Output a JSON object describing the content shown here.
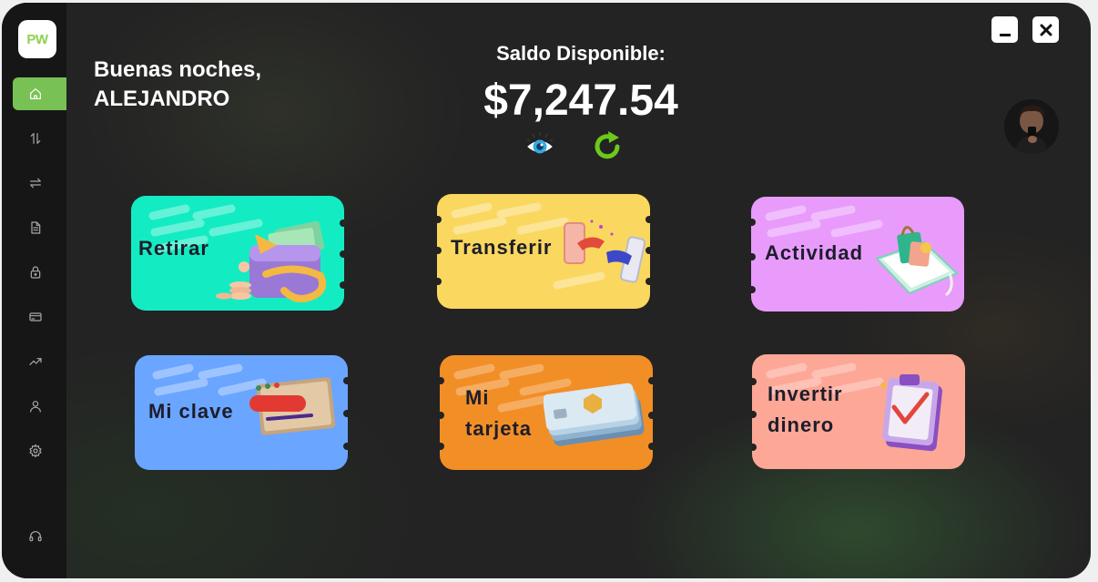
{
  "sidebar": {
    "logo_text": "PW",
    "items": [
      {
        "name": "home",
        "icon": "home-icon",
        "active": true
      },
      {
        "name": "transactions",
        "icon": "sort-arrows-icon"
      },
      {
        "name": "transfer",
        "icon": "swap-arrows-icon"
      },
      {
        "name": "documents",
        "icon": "document-icon"
      },
      {
        "name": "security",
        "icon": "lock-icon"
      },
      {
        "name": "cards",
        "icon": "credit-card-icon"
      },
      {
        "name": "investments",
        "icon": "trending-up-icon"
      },
      {
        "name": "profile",
        "icon": "user-icon"
      },
      {
        "name": "settings",
        "icon": "gear-icon"
      },
      {
        "name": "support",
        "icon": "headset-icon"
      }
    ]
  },
  "header": {
    "greeting_line1": "Buenas noches,",
    "greeting_line2": "ALEJANDRO",
    "balance_label": "Saldo Disponible:",
    "balance_value": "$7,247.54"
  },
  "cards": [
    {
      "id": "retirar",
      "label": "Retirar",
      "color": "#13ecc3"
    },
    {
      "id": "transferir",
      "label": "Transferir",
      "color": "#fad75e"
    },
    {
      "id": "actividad",
      "label": "Actividad",
      "color": "#e89bfb"
    },
    {
      "id": "mi-clave",
      "label": "Mi clave",
      "color": "#6aa5ff"
    },
    {
      "id": "mi-tarjeta",
      "label": "Mi\ntarjeta",
      "color": "#f28e26"
    },
    {
      "id": "invertir",
      "label": "Invertir\ndinero",
      "color": "#fda796"
    }
  ],
  "colors": {
    "accent": "#78c154",
    "background": "#232323",
    "sidebar": "#161616"
  }
}
